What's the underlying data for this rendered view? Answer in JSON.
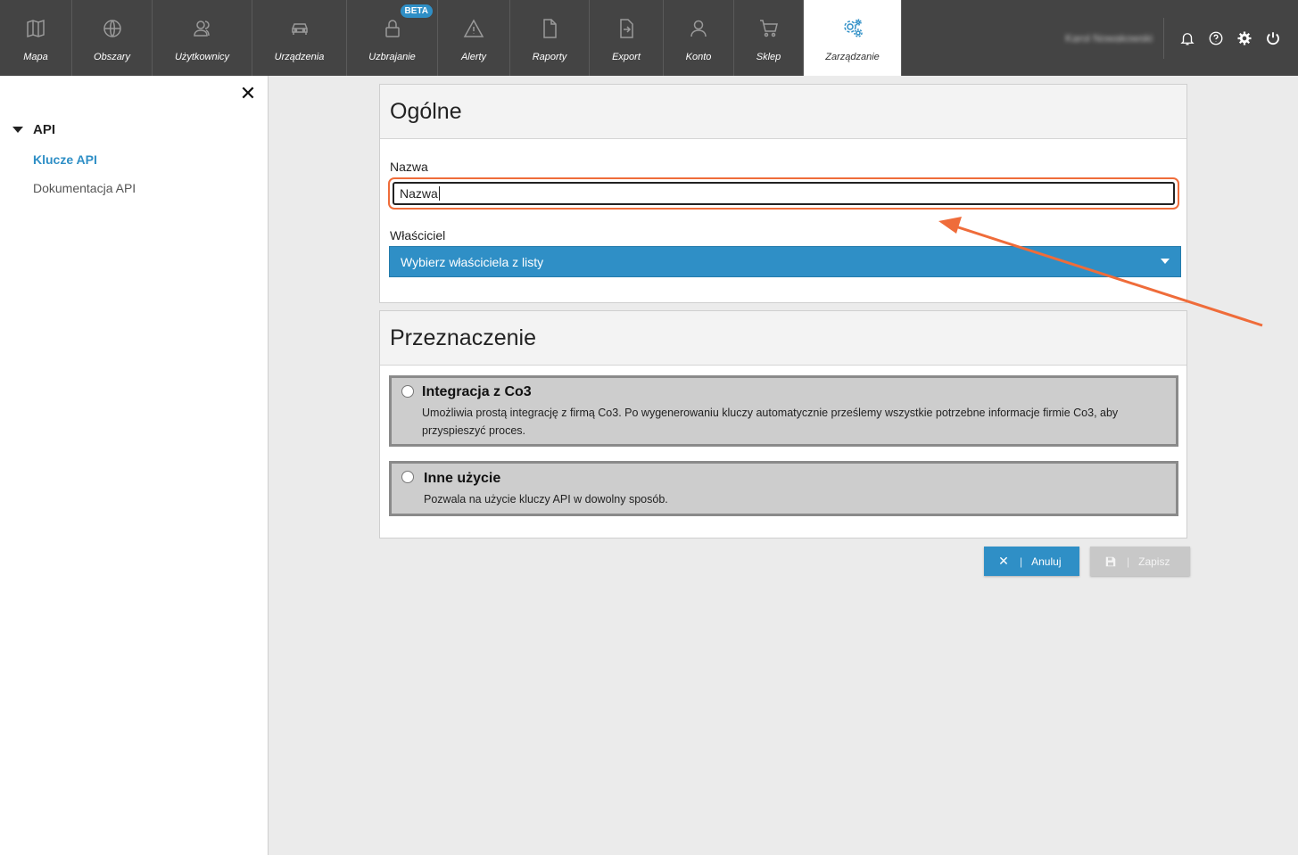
{
  "topnav": {
    "items": [
      {
        "label": "Mapa",
        "icon": "map-icon"
      },
      {
        "label": "Obszary",
        "icon": "globe-icon"
      },
      {
        "label": "Użytkownicy",
        "icon": "users-icon"
      },
      {
        "label": "Urządzenia",
        "icon": "car-icon"
      },
      {
        "label": "Uzbrajanie",
        "icon": "lock-icon",
        "badge": "BETA"
      },
      {
        "label": "Alerty",
        "icon": "alert-icon"
      },
      {
        "label": "Raporty",
        "icon": "document-icon"
      },
      {
        "label": "Export",
        "icon": "export-icon"
      },
      {
        "label": "Konto",
        "icon": "user-icon"
      },
      {
        "label": "Sklep",
        "icon": "cart-icon"
      },
      {
        "label": "Zarządzanie",
        "icon": "gears-icon",
        "active": true
      }
    ],
    "username": "Karol Nowakowski",
    "tools": [
      "bell-icon",
      "help-icon",
      "gear-icon",
      "power-icon"
    ]
  },
  "sidebar": {
    "close_label": "✕",
    "section": "API",
    "links": [
      {
        "label": "Klucze API",
        "active": true
      },
      {
        "label": "Dokumentacja API",
        "active": false
      }
    ]
  },
  "general": {
    "title": "Ogólne",
    "name_label": "Nazwa",
    "name_value": "Nazwa",
    "owner_label": "Właściciel",
    "owner_placeholder": "Wybierz właściciela z listy"
  },
  "purpose": {
    "title": "Przeznaczenie",
    "options": [
      {
        "title": "Integracja z Co3",
        "desc": "Umożliwia prostą integrację z firmą Co3. Po wygenerowaniu kluczy automatycznie prześlemy wszystkie potrzebne informacje firmie Co3, aby przyspieszyć proces."
      },
      {
        "title": "Inne użycie",
        "desc": "Pozwala na użycie kluczy API w dowolny sposób."
      }
    ]
  },
  "actions": {
    "cancel_label": "Anuluj",
    "save_label": "Zapisz"
  },
  "colors": {
    "accent": "#2f8fc6",
    "highlight": "#ef6c3a",
    "nav_bg": "#444444"
  }
}
